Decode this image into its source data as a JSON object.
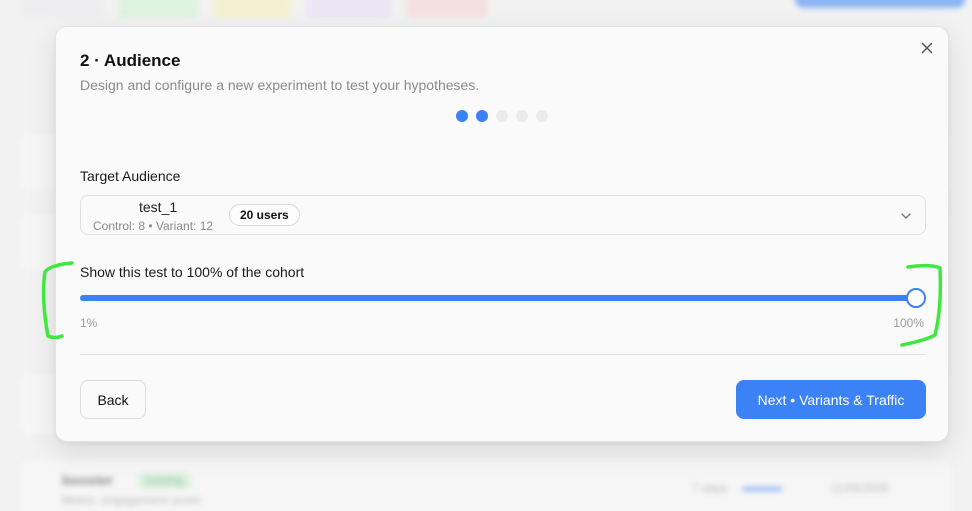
{
  "background": {
    "row_title": "booster",
    "row_badge": "running",
    "row_sub": "Metric: engagement score",
    "row_days": "7 days",
    "row_date": "11/05/2025"
  },
  "dialog": {
    "title": "2 · Audience",
    "subtitle": "Design and configure a new experiment to test your hypotheses.",
    "steps": {
      "total": 5,
      "current": 2
    },
    "target_audience": {
      "label": "Target Audience",
      "cohort_name": "test_1",
      "cohort_split": "Control: 8 • Variant: 12",
      "user_count": "20 users"
    },
    "exposure": {
      "label": "Show this test to 100% of the cohort",
      "min_label": "1%",
      "max_label": "100%",
      "value_percent": 100
    },
    "buttons": {
      "back": "Back",
      "next": "Next • Variants & Traffic"
    }
  },
  "colors": {
    "accent": "#3b82f6",
    "annotation": "#3ee83e"
  },
  "icons": {
    "close": "close-icon",
    "dropdown": "chevron-down-icon"
  }
}
